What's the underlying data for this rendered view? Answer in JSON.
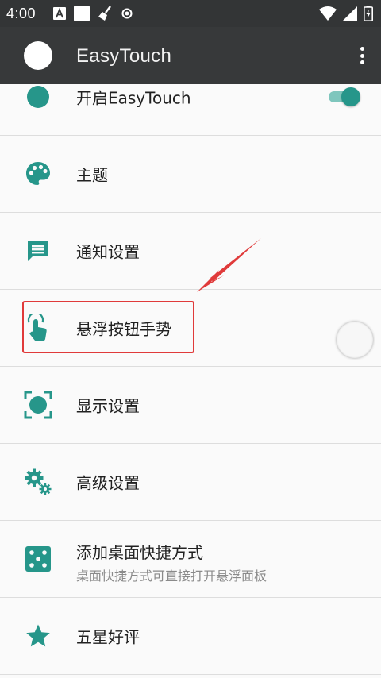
{
  "status_bar": {
    "time": "4:00",
    "left_icons": [
      "font-a-icon",
      "white-square-icon",
      "broom-icon",
      "record-icon"
    ],
    "right_icons": [
      "wifi-icon",
      "signal-icon",
      "battery-charging-icon"
    ]
  },
  "app_bar": {
    "title": "EasyTouch",
    "menu_icon": "more-vert-icon"
  },
  "accent_color": "#26968a",
  "items": [
    {
      "label": "开启EasyTouch",
      "icon": "toggle-dot-icon",
      "toggle_on": true
    },
    {
      "label": "主题",
      "icon": "palette-icon"
    },
    {
      "label": "通知设置",
      "icon": "message-icon"
    },
    {
      "label": "悬浮按钮手势",
      "icon": "touch-gesture-icon"
    },
    {
      "label": "显示设置",
      "icon": "display-focus-icon"
    },
    {
      "label": "高级设置",
      "icon": "gears-icon"
    },
    {
      "label": "添加桌面快捷方式",
      "sublabel": "桌面快捷方式可直接打开悬浮面板",
      "icon": "dice-icon"
    },
    {
      "label": "五星好评",
      "icon": "star-icon"
    }
  ],
  "annotation": {
    "highlight_color": "#e03a3a"
  }
}
